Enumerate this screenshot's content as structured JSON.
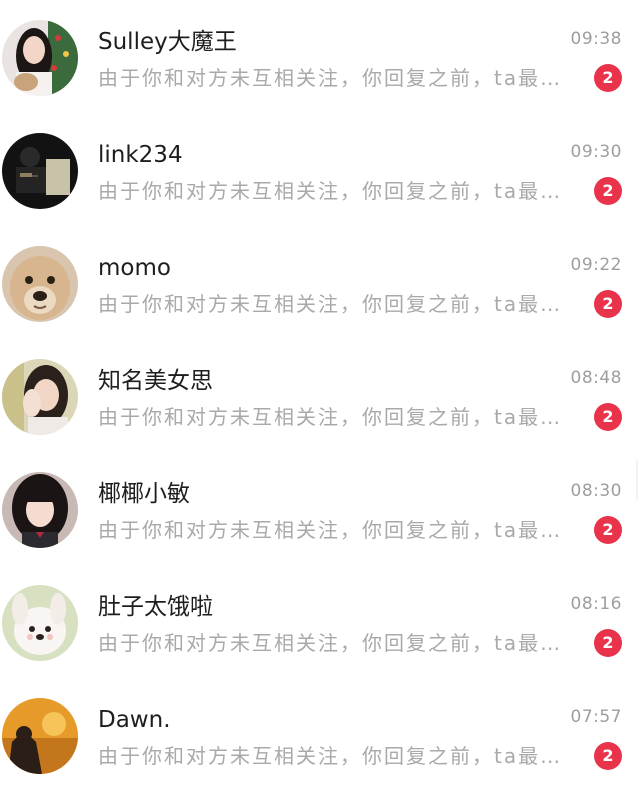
{
  "conversations": [
    {
      "name": "Sulley大魔王",
      "time": "09:38",
      "preview": "由于你和对方未互相关注，你回复之前，ta最多只能发送一条消息",
      "badge": "2",
      "avatar_icon": "avatar-girl-christmas"
    },
    {
      "name": "link234",
      "time": "09:30",
      "preview": "由于你和对方未互相关注，你回复之前，ta最多只能发送一条消息",
      "badge": "2",
      "avatar_icon": "avatar-dark-figure"
    },
    {
      "name": "momo",
      "time": "09:22",
      "preview": "由于你和对方未互相关注，你回复之前，ta最多只能发送一条消息",
      "badge": "2",
      "avatar_icon": "avatar-dog"
    },
    {
      "name": "知名美女思",
      "time": "08:48",
      "preview": "由于你和对方未互相关注，你回复之前，ta最多只能发送一条消息",
      "badge": "2",
      "avatar_icon": "avatar-girl-hand"
    },
    {
      "name": "椰椰小敏",
      "time": "08:30",
      "preview": "由于你和对方未互相关注，你回复之前，ta最多只能发送一条消息",
      "badge": "2",
      "avatar_icon": "avatar-girl-dark-hair"
    },
    {
      "name": "肚子太饿啦",
      "time": "08:16",
      "preview": "由于你和对方未互相关注，你回复之前，ta最多只能发送一条消息",
      "badge": "2",
      "avatar_icon": "avatar-white-puppy"
    },
    {
      "name": "Dawn.",
      "time": "07:57",
      "preview": "由于你和对方未互相关注，你回复之前，ta最多只能发送一条消息",
      "badge": "2",
      "avatar_icon": "avatar-orange-sunset"
    }
  ],
  "colors": {
    "badge": "#e8334a",
    "name": "#1e1e1e",
    "preview": "#a9a9a9",
    "time": "#9e9e9e"
  }
}
